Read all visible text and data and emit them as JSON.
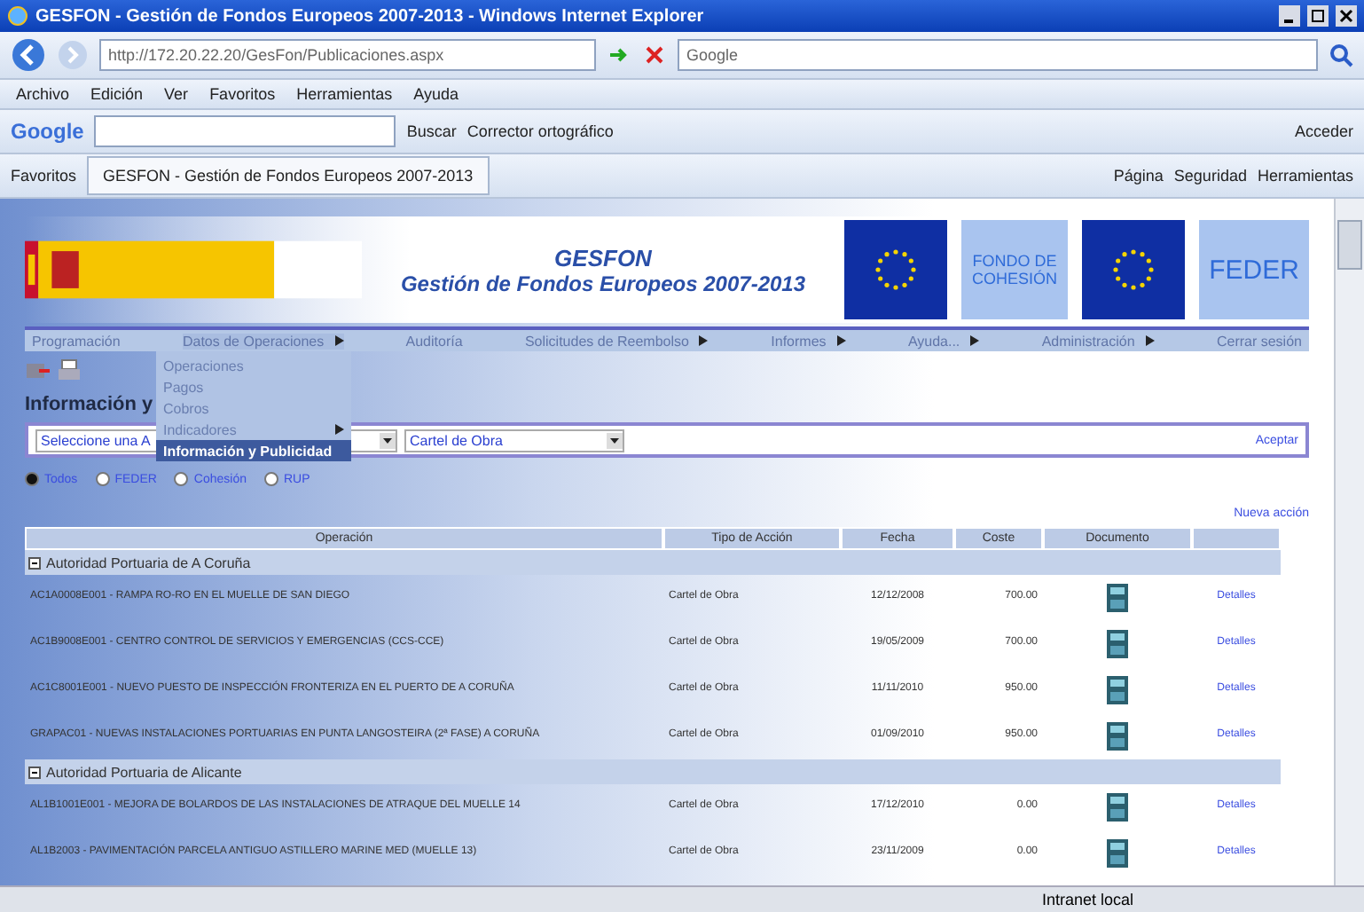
{
  "window": {
    "title": "GESFON - Gestión de Fondos Europeos 2007-2013 - Windows Internet Explorer"
  },
  "address_bar": {
    "url": "http://172.20.22.20/GesFon/Publicaciones.aspx",
    "search_placeholder": "Google"
  },
  "menu_bar": [
    "Archivo",
    "Edición",
    "Ver",
    "Favoritos",
    "Herramientas",
    "Ayuda"
  ],
  "google_toolbar": {
    "logo": "Google",
    "search_button": "Buscar",
    "spell_check": "Corrector ortográfico",
    "sign_in": "Acceder"
  },
  "favorites_bar": {
    "favorites": "Favoritos",
    "tab": "GESFON - Gestión de Fondos Europeos 2007-2013",
    "commands": [
      "Página",
      "Seguridad",
      "Herramientas"
    ]
  },
  "page": {
    "header": {
      "title": "GESFON",
      "subtitle": "Gestión de Fondos Europeos 2007-2013",
      "fund_logo": "FONDO DE COHESIÓN",
      "feder_logo": "FEDER"
    },
    "nav": [
      {
        "label": "Programación",
        "has_submenu": false,
        "open": false
      },
      {
        "label": "Datos de Operaciones",
        "has_submenu": true,
        "open": true
      },
      {
        "label": "Auditoría",
        "has_submenu": false,
        "open": false
      },
      {
        "label": "Solicitudes de Reembolso",
        "has_submenu": true,
        "open": false
      },
      {
        "label": "Informes",
        "has_submenu": true,
        "open": false
      },
      {
        "label": "Ayuda...",
        "has_submenu": true,
        "open": false
      },
      {
        "label": "Administración",
        "has_submenu": true,
        "open": false
      },
      {
        "label": "Cerrar sesión",
        "has_submenu": false,
        "open": false
      }
    ],
    "submenu": [
      {
        "label": "Operaciones",
        "has_submenu": false,
        "selected": false
      },
      {
        "label": "Pagos",
        "has_submenu": false,
        "selected": false
      },
      {
        "label": "Cobros",
        "has_submenu": false,
        "selected": false
      },
      {
        "label": "Indicadores",
        "has_submenu": true,
        "selected": false
      },
      {
        "label": "Información y Publicidad",
        "has_submenu": false,
        "selected": true
      }
    ],
    "heading": "Información y",
    "filter": {
      "authority": "Seleccione una A",
      "action_type": "Cartel de Obra",
      "accept": "Aceptar"
    },
    "fund_options": [
      {
        "label": "Todos",
        "selected": true
      },
      {
        "label": "FEDER",
        "selected": false
      },
      {
        "label": "Cohesión",
        "selected": false
      },
      {
        "label": "RUP",
        "selected": false
      }
    ],
    "new_action": "Nueva acción",
    "table": {
      "columns": [
        "Operación",
        "Tipo de Acción",
        "Fecha",
        "Coste",
        "Documento"
      ],
      "groups": [
        {
          "name": "Autoridad Portuaria de A Coruña",
          "expanded": true,
          "rows": [
            {
              "operation": "AC1A0008E001 - RAMPA RO-RO EN EL MUELLE DE SAN DIEGO",
              "type": "Cartel de Obra",
              "date": "12/12/2008",
              "cost": "700.00",
              "link": "Detalles"
            },
            {
              "operation": "AC1B9008E001 - CENTRO CONTROL DE SERVICIOS Y EMERGENCIAS (CCS-CCE)",
              "type": "Cartel de Obra",
              "date": "19/05/2009",
              "cost": "700.00",
              "link": "Detalles"
            },
            {
              "operation": "AC1C8001E001 - NUEVO PUESTO DE INSPECCIÓN FRONTERIZA EN EL PUERTO DE A CORUÑA",
              "type": "Cartel de Obra",
              "date": "11/11/2010",
              "cost": "950.00",
              "link": "Detalles"
            },
            {
              "operation": "GRAPAC01 - NUEVAS INSTALACIONES PORTUARIAS EN PUNTA LANGOSTEIRA (2ª FASE) A CORUÑA",
              "type": "Cartel de Obra",
              "date": "01/09/2010",
              "cost": "950.00",
              "link": "Detalles"
            }
          ]
        },
        {
          "name": "Autoridad Portuaria de Alicante",
          "expanded": true,
          "rows": [
            {
              "operation": "AL1B1001E001 - MEJORA DE BOLARDOS DE LAS INSTALACIONES DE ATRAQUE DEL MUELLE 14",
              "type": "Cartel de Obra",
              "date": "17/12/2010",
              "cost": "0.00",
              "link": "Detalles"
            },
            {
              "operation": "AL1B2003 - PAVIMENTACIÓN PARCELA ANTIGUO ASTILLERO MARINE MED (MUELLE 13)",
              "type": "Cartel de Obra",
              "date": "23/11/2009",
              "cost": "0.00",
              "link": "Detalles"
            }
          ]
        }
      ]
    }
  },
  "status_bar": {
    "zone": "Intranet local"
  }
}
